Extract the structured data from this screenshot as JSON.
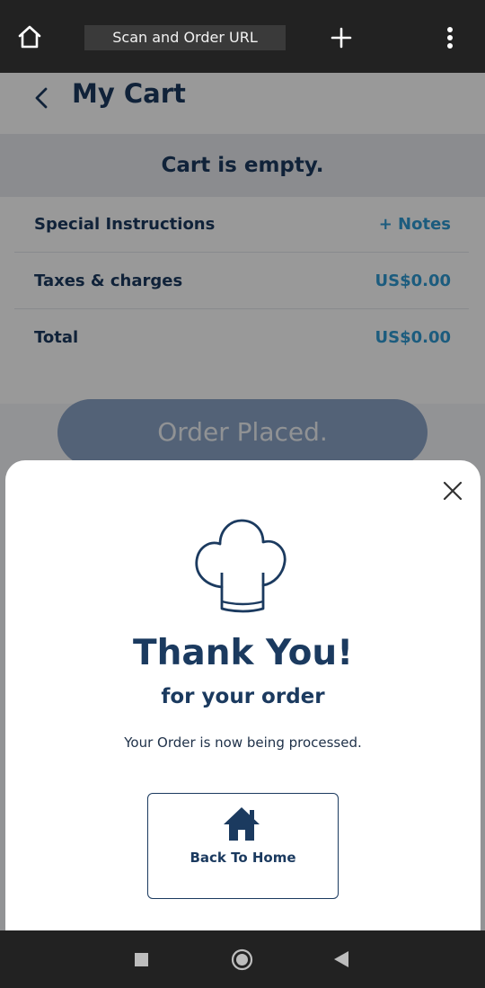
{
  "browser": {
    "url_label": "Scan and Order URL",
    "icons": {
      "home": "home-icon",
      "new_tab": "plus-icon",
      "menu": "vertical-dots-icon"
    }
  },
  "header": {
    "title": "My Cart",
    "back_icon": "chevron-left-icon"
  },
  "cart": {
    "empty_message": "Cart is empty.",
    "rows": [
      {
        "label": "Special Instructions",
        "value": "+ Notes"
      },
      {
        "label": "Taxes & charges",
        "value": "US$0.00"
      },
      {
        "label": "Total",
        "value": "US$0.00"
      }
    ],
    "order_button": "Order Placed."
  },
  "modal": {
    "icon": "chef-hat-icon",
    "title": "Thank You!",
    "subtitle": "for your order",
    "message": "Your Order is now being processed.",
    "home_button": "Back To Home",
    "home_icon": "house-icon",
    "close_icon": "close-icon"
  },
  "colors": {
    "primary_navy": "#1b3a5f",
    "accent_blue": "#2f9ad3",
    "overlay": "rgba(0,0,0,0.40)"
  }
}
